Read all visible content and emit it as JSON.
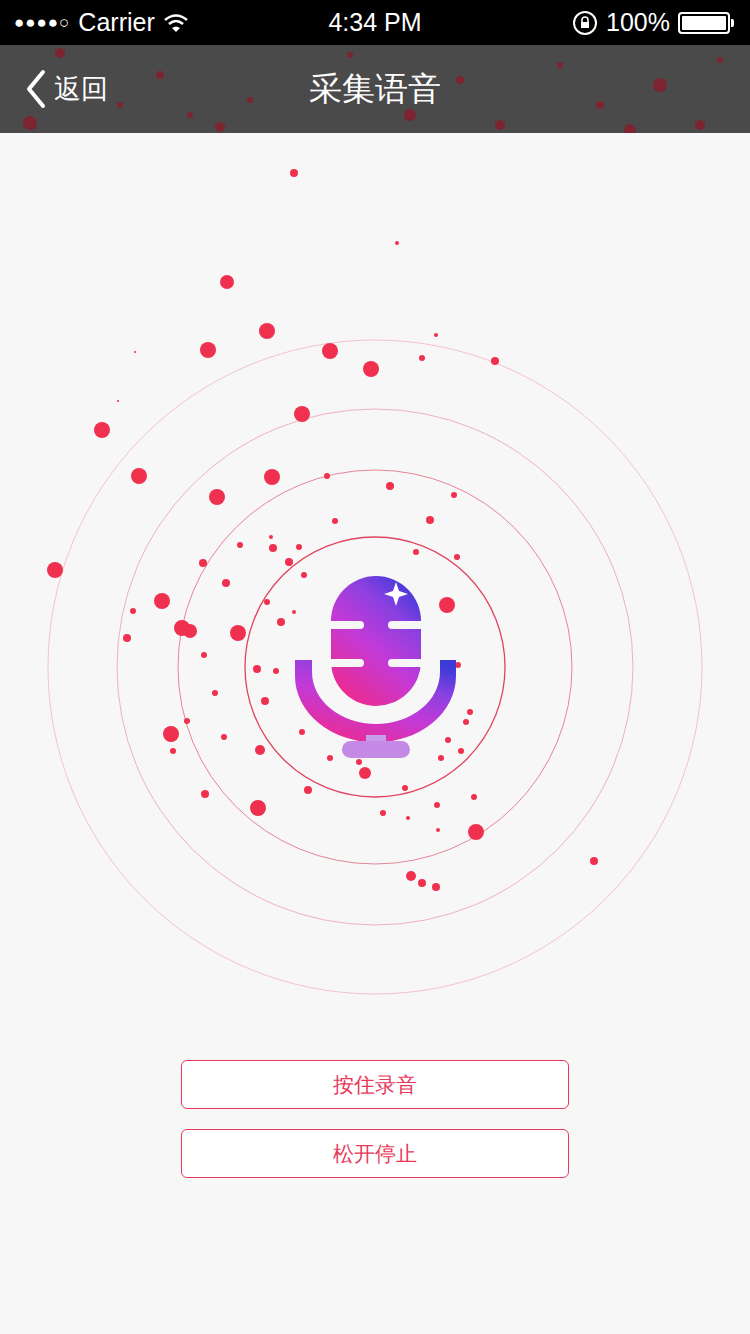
{
  "status_bar": {
    "signal": "●●●●○",
    "carrier": "Carrier",
    "time": "4:34 PM",
    "battery": "100%",
    "battery_level": 1
  },
  "nav": {
    "back": "返回",
    "title": "采集语音"
  },
  "buttons": [
    {
      "label": "按住录音"
    },
    {
      "label": "松开停止"
    }
  ]
}
